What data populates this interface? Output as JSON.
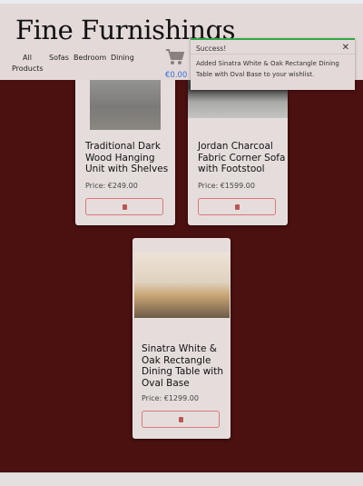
{
  "header": {
    "logo": "Fine Furnishings",
    "nav": [
      "All Products",
      "Sofas",
      "Bedroom",
      "Dining"
    ],
    "cart_total": "€0.00"
  },
  "toast": {
    "title": "Success!",
    "close": "✕",
    "message": "Added Sinatra White & Oak Rectangle Dining Table with Oval Base to your wishlist."
  },
  "products": [
    {
      "title": "Traditional Dark Wood Hanging Unit with Shelves",
      "price": "Price: €249.00"
    },
    {
      "title": "Jordan Charcoal Fabric Corner Sofa with Footstool",
      "price": "Price: €1599.00"
    },
    {
      "title": "Sinatra White & Oak Rectangle Dining Table with Oval Base",
      "price": "Price: €1299.00"
    }
  ],
  "colors": {
    "header": "#e3d9d8",
    "background": "#4b1010",
    "success": "#2fa845",
    "link": "#3a6fd6"
  }
}
